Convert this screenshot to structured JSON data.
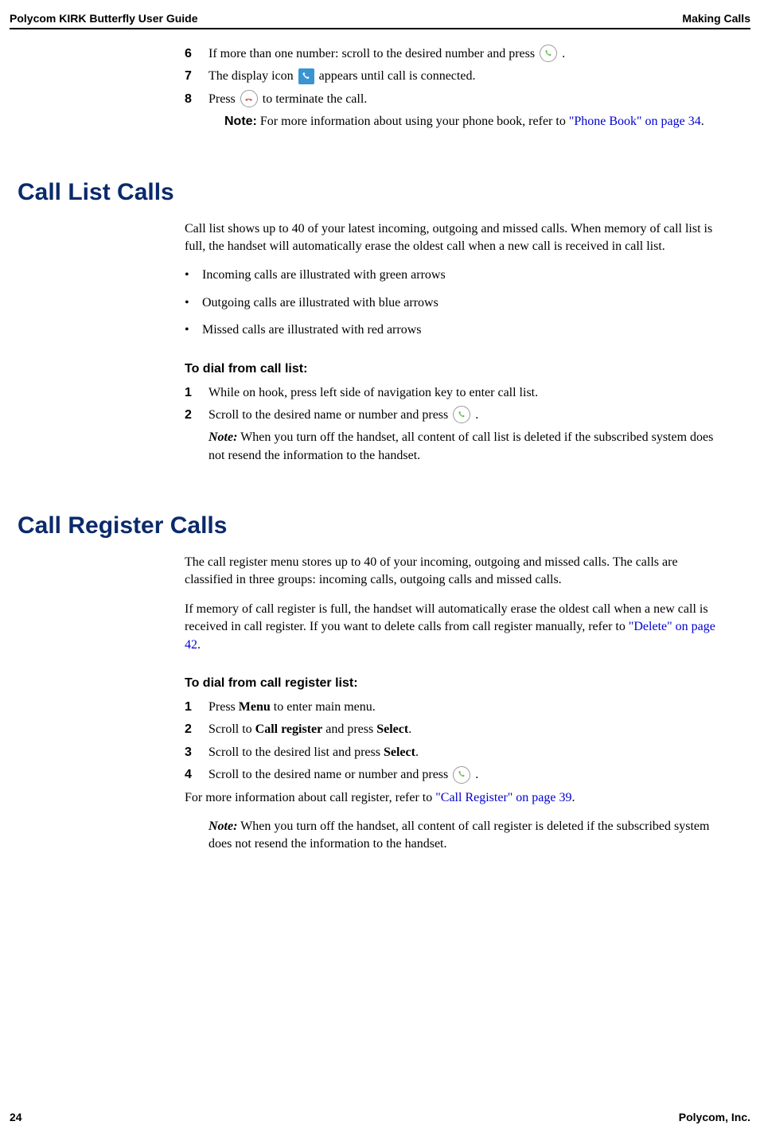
{
  "header": {
    "left": "Polycom KIRK Butterfly User Guide",
    "right": "Making Calls"
  },
  "intro_steps": {
    "s6": {
      "num": "6",
      "text_a": "If more than one number: scroll to the desired number and press ",
      "text_b": " ."
    },
    "s7": {
      "num": "7",
      "text_a": "The display icon ",
      "text_b": " appears until call is connected."
    },
    "s8": {
      "num": "8",
      "text_a": "Press ",
      "text_b": " to terminate the call."
    },
    "note_label": "Note:",
    "note_text": " For more information about using your phone book, refer to ",
    "note_link": "\"Phone Book\" on page 34",
    "note_tail": "."
  },
  "sec1": {
    "heading": "Call List Calls",
    "para": "Call list shows up to 40 of your latest incoming, outgoing and missed calls. When memory of call list is full, the handset will automatically erase the oldest call when a new call is received in call list.",
    "bullets": {
      "b1": "Incoming calls are illustrated with green arrows",
      "b2": "Outgoing calls are illustrated with blue arrows",
      "b3": "Missed calls are illustrated with red arrows"
    },
    "sub": "To dial from call list:",
    "steps": {
      "s1": {
        "num": "1",
        "text": "While on hook, press left side of navigation key to enter call list."
      },
      "s2": {
        "num": "2",
        "text_a": "Scroll to the desired name or number and press  ",
        "text_b": "."
      }
    },
    "note_label": "Note:",
    "note_text": " When you turn off the handset, all content of call list is deleted if the subscribed system does not resend the information to the handset."
  },
  "sec2": {
    "heading": "Call Register Calls",
    "para1": "The call register menu stores up to 40 of your incoming, outgoing and missed calls. The calls are classified in three groups: incoming calls, outgoing calls and missed calls.",
    "para2_a": "If memory of call register is full, the handset will automatically erase the oldest call when a new call is received in call register. If you want to delete calls from call register manually, refer to ",
    "para2_link": "\"Delete\" on page 42",
    "para2_b": ".",
    "sub": "To dial from call register list:",
    "steps": {
      "s1": {
        "num": "1",
        "text_a": "Press ",
        "bold1": "Menu",
        "text_b": " to enter main menu."
      },
      "s2": {
        "num": "2",
        "text_a": "Scroll to ",
        "bold1": "Call register",
        "text_b": " and press ",
        "bold2": "Select",
        "text_c": "."
      },
      "s3": {
        "num": "3",
        "text_a": "Scroll to the desired list and press ",
        "bold1": "Select",
        "text_b": "."
      },
      "s4": {
        "num": "4",
        "text_a": "Scroll to the desired name or number and press ",
        "text_b": " ."
      }
    },
    "tail_a": "For more information about call register, refer to ",
    "tail_link": "\"Call Register\" on page 39",
    "tail_b": ".",
    "note_label": "Note:",
    "note_text": " When you turn off the handset, all content of call register is deleted if the subscribed system does not resend the information to the handset."
  },
  "footer": {
    "left": "24",
    "right": "Polycom, Inc."
  }
}
